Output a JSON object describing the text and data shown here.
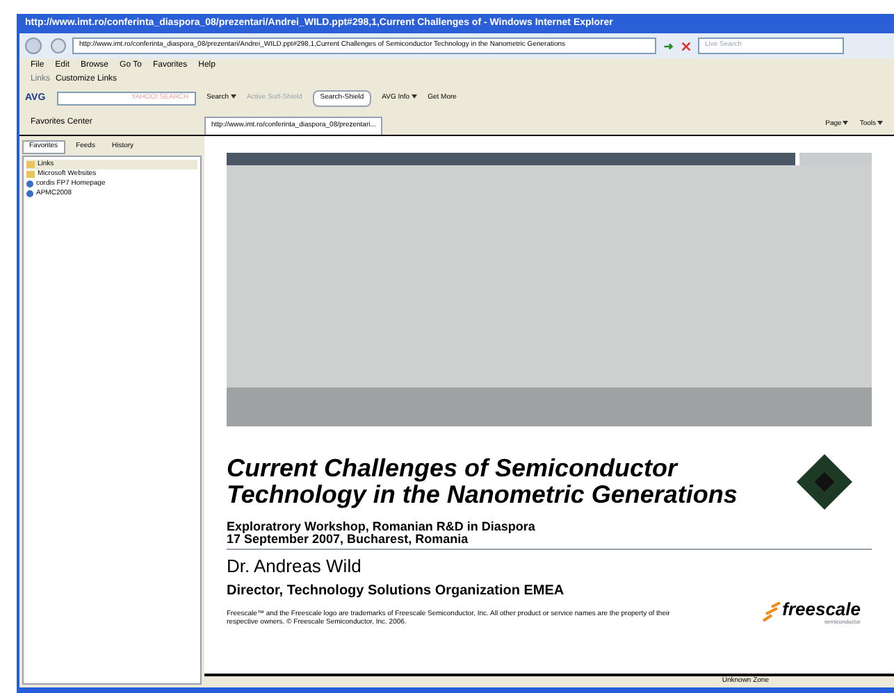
{
  "window": {
    "title": "http://www.imt.ro/conferinta_diaspora_08/prezentari/Andrei_WILD.ppt#298,1,Current Challenges of - Windows Internet Explorer"
  },
  "nav": {
    "address": "http://www.imt.ro/conferinta_diaspora_08/prezentari/Andrei_WILD.ppt#298,1,Current Challenges of Semiconductor Technology in the Nanometric Generations",
    "search_placeholder": "Live Search"
  },
  "menu": [
    "File",
    "Edit",
    "Browse",
    "Go To",
    "Favorites",
    "Help"
  ],
  "links_bar": {
    "label": "Links",
    "items": [
      "Customize Links"
    ]
  },
  "avg_toolbar": {
    "brand": "AVG",
    "search_placeholder": "YAHOO! SEARCH",
    "items": [
      {
        "label": "Search",
        "disabled": false,
        "kind": "menu"
      },
      {
        "label": "Active Surf-Shield",
        "disabled": true,
        "kind": "plain"
      },
      {
        "label": "Search-Shield",
        "disabled": false,
        "kind": "boxed"
      },
      {
        "label": "AVG Info",
        "disabled": false,
        "kind": "menu"
      },
      {
        "label": "Get More",
        "disabled": false,
        "kind": "plain"
      }
    ]
  },
  "favorites_center": {
    "title": "Favorites Center",
    "tabs": [
      {
        "label": "Favorites",
        "selected": true
      },
      {
        "label": "Feeds",
        "selected": false
      },
      {
        "label": "History",
        "selected": false
      }
    ],
    "items": [
      {
        "label": "Links",
        "kind": "folder",
        "selected": true
      },
      {
        "label": "Microsoft Websites",
        "kind": "folder",
        "selected": false
      },
      {
        "label": "cordis FP7 Homepage",
        "kind": "page",
        "selected": false
      },
      {
        "label": "APMC2008",
        "kind": "page",
        "selected": false
      }
    ]
  },
  "browser_tab": {
    "title": "http://www.imt.ro/conferinta_diaspora_08/prezentari..."
  },
  "command_bar": [
    "Page",
    "Tools"
  ],
  "slide": {
    "title": "Current Challenges of Semiconductor Technology in the Nanometric Generations",
    "event": "Exploratrory Workshop, Romanian R&D in Diaspora",
    "date": "17 September 2007, Bucharest, Romania",
    "presenter": "Dr. Andreas Wild",
    "role": "Director, Technology Solutions Organization EMEA",
    "fine_print": "Freescale™ and the Freescale logo are trademarks of Freescale Semiconductor, Inc. All other product or service names are the property of their respective owners. © Freescale Semiconductor, Inc. 2006.",
    "logo": "freescale",
    "logo_sub": "semiconductor"
  },
  "status_bar": {
    "zone": "Unknown Zone"
  }
}
